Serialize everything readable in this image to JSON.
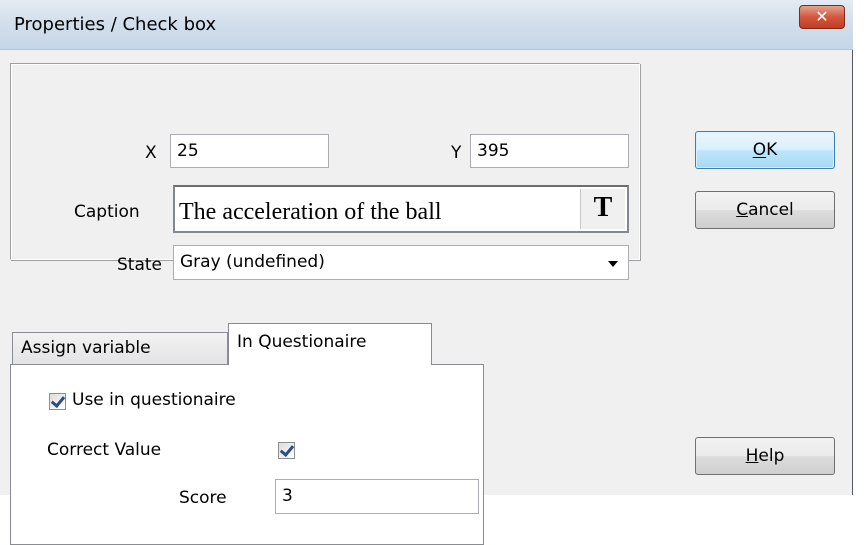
{
  "window": {
    "title": "Properties / Check box",
    "close_glyph": "✕"
  },
  "position": {
    "x_label": "X",
    "x_value": "25",
    "y_label": "Y",
    "y_value": "395"
  },
  "caption": {
    "label": "Caption",
    "value": "The acceleration of the ball",
    "font_button": "T"
  },
  "state": {
    "label": "State",
    "value": "Gray (undefined)"
  },
  "buttons": {
    "ok": "OK",
    "cancel": "Cancel",
    "help": "Help"
  },
  "tabs": {
    "items": [
      {
        "label": "Assign variable",
        "active": false
      },
      {
        "label": "In Questionaire",
        "active": true
      }
    ]
  },
  "questionaire": {
    "use_label": "Use in questionaire",
    "use_checked": true,
    "correct_label": "Correct Value",
    "correct_checked": true,
    "score_label": "Score",
    "score_value": "3"
  },
  "icons": {
    "close": "close-icon",
    "dropdown": "chevron-down-icon",
    "checkbox": "checkmark-icon"
  }
}
